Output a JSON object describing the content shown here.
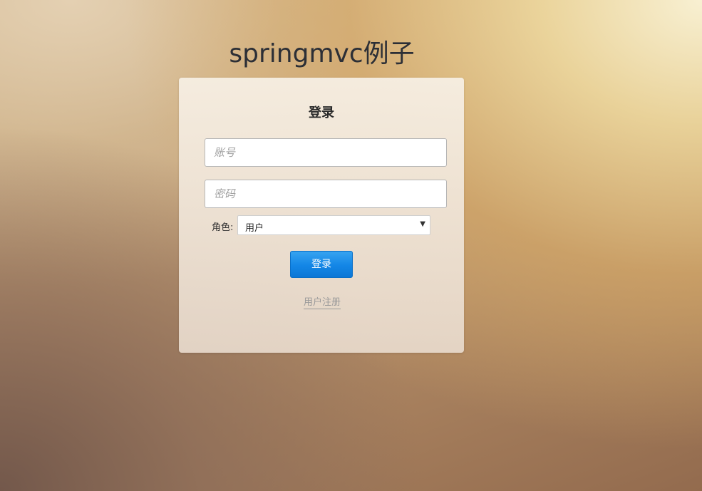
{
  "page": {
    "title": "springmvc例子"
  },
  "login_card": {
    "title": "登录",
    "account_input": {
      "placeholder": "账号",
      "value": ""
    },
    "password_input": {
      "placeholder": "密码",
      "value": ""
    },
    "role": {
      "label": "角色:",
      "selected": "用户"
    },
    "login_button_label": "登录",
    "register_link_label": "用户注册"
  },
  "colors": {
    "button_blue": "#1386e6",
    "title_text": "#2c2f36",
    "link_gray": "#9a9a9a"
  },
  "icons": {
    "select_arrow": "triangle-down-icon"
  }
}
